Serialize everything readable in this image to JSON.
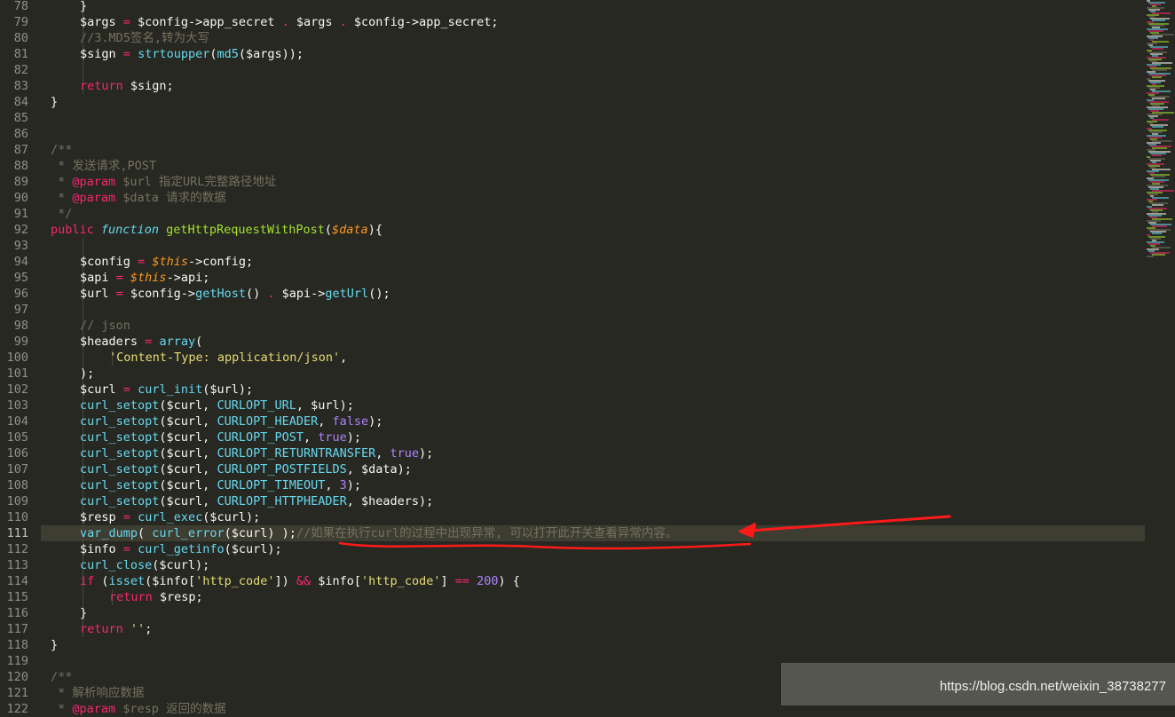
{
  "editor": {
    "theme_colors": {
      "background": "#272822",
      "foreground": "#f8f8f2",
      "keyword": "#f92672",
      "function": "#a6e22e",
      "builtin": "#66d9ef",
      "variable_italic": "#fd971f",
      "comment": "#75715e",
      "string": "#e6db74",
      "constant": "#ae81ff",
      "line_number": "#90908a",
      "active_line": "#3e3d32"
    },
    "active_line": 111,
    "lines": [
      {
        "n": "78",
        "indent": 2,
        "tokens": [
          [
            "pl",
            "}"
          ]
        ]
      },
      {
        "n": "79",
        "indent": 2,
        "tokens": [
          [
            "pl",
            "$args "
          ],
          [
            "kw",
            "="
          ],
          [
            "pl",
            " $config->app_secret "
          ],
          [
            "kw",
            "."
          ],
          [
            "pl",
            " $args "
          ],
          [
            "kw",
            "."
          ],
          [
            "pl",
            " $config->app_secret;"
          ]
        ]
      },
      {
        "n": "80",
        "indent": 2,
        "tokens": [
          [
            "cm",
            "//3.MD5签名,转为大写"
          ]
        ]
      },
      {
        "n": "81",
        "indent": 2,
        "tokens": [
          [
            "pl",
            "$sign "
          ],
          [
            "kw",
            "="
          ],
          [
            "pl",
            " "
          ],
          [
            "bi",
            "strtoupper"
          ],
          [
            "pl",
            "("
          ],
          [
            "bi",
            "md5"
          ],
          [
            "pl",
            "($args));"
          ]
        ]
      },
      {
        "n": "82",
        "indent": 2,
        "tokens": []
      },
      {
        "n": "83",
        "indent": 2,
        "tokens": [
          [
            "kw",
            "return"
          ],
          [
            "pl",
            " $sign;"
          ]
        ]
      },
      {
        "n": "84",
        "indent": 1,
        "tokens": [
          [
            "pl",
            "}"
          ]
        ]
      },
      {
        "n": "85",
        "indent": 1,
        "tokens": []
      },
      {
        "n": "86",
        "indent": 1,
        "tokens": []
      },
      {
        "n": "87",
        "indent": 1,
        "tokens": [
          [
            "cm",
            "/**"
          ]
        ]
      },
      {
        "n": "88",
        "indent": 1,
        "tokens": [
          [
            "cm",
            " * 发送请求,POST"
          ]
        ]
      },
      {
        "n": "89",
        "indent": 1,
        "tokens": [
          [
            "cm",
            " * "
          ],
          [
            "kw",
            "@param"
          ],
          [
            "cm",
            " $url 指定URL完整路径地址"
          ]
        ]
      },
      {
        "n": "90",
        "indent": 1,
        "tokens": [
          [
            "cm",
            " * "
          ],
          [
            "kw",
            "@param"
          ],
          [
            "cm",
            " $data 请求的数据"
          ]
        ]
      },
      {
        "n": "91",
        "indent": 1,
        "tokens": [
          [
            "cm",
            " */"
          ]
        ]
      },
      {
        "n": "92",
        "indent": 1,
        "tokens": [
          [
            "kw",
            "public"
          ],
          [
            "pl",
            " "
          ],
          [
            "st",
            "function"
          ],
          [
            "pl",
            " "
          ],
          [
            "fn",
            "getHttpRequestWithPost"
          ],
          [
            "pl",
            "("
          ],
          [
            "vi",
            "$data"
          ],
          [
            "pl",
            "){"
          ]
        ]
      },
      {
        "n": "93",
        "indent": 2,
        "tokens": []
      },
      {
        "n": "94",
        "indent": 2,
        "tokens": [
          [
            "pl",
            "$config "
          ],
          [
            "kw",
            "="
          ],
          [
            "pl",
            " "
          ],
          [
            "vi",
            "$this"
          ],
          [
            "pl",
            "->config;"
          ]
        ]
      },
      {
        "n": "95",
        "indent": 2,
        "tokens": [
          [
            "pl",
            "$api "
          ],
          [
            "kw",
            "="
          ],
          [
            "pl",
            " "
          ],
          [
            "vi",
            "$this"
          ],
          [
            "pl",
            "->api;"
          ]
        ]
      },
      {
        "n": "96",
        "indent": 2,
        "tokens": [
          [
            "pl",
            "$url "
          ],
          [
            "kw",
            "="
          ],
          [
            "pl",
            " $config->"
          ],
          [
            "bi",
            "getHost"
          ],
          [
            "pl",
            "() "
          ],
          [
            "kw",
            "."
          ],
          [
            "pl",
            " $api->"
          ],
          [
            "bi",
            "getUrl"
          ],
          [
            "pl",
            "();"
          ]
        ]
      },
      {
        "n": "97",
        "indent": 2,
        "tokens": []
      },
      {
        "n": "98",
        "indent": 2,
        "tokens": [
          [
            "cm",
            "// json"
          ]
        ]
      },
      {
        "n": "99",
        "indent": 2,
        "tokens": [
          [
            "pl",
            "$headers "
          ],
          [
            "kw",
            "="
          ],
          [
            "pl",
            " "
          ],
          [
            "bi",
            "array"
          ],
          [
            "pl",
            "("
          ]
        ]
      },
      {
        "n": "100",
        "indent": 3,
        "tokens": [
          [
            "str",
            "'Content-Type: application/json'"
          ],
          [
            "pl",
            ","
          ]
        ]
      },
      {
        "n": "101",
        "indent": 2,
        "tokens": [
          [
            "pl",
            ");"
          ]
        ]
      },
      {
        "n": "102",
        "indent": 2,
        "tokens": [
          [
            "pl",
            "$curl "
          ],
          [
            "kw",
            "="
          ],
          [
            "pl",
            " "
          ],
          [
            "bi",
            "curl_init"
          ],
          [
            "pl",
            "($url);"
          ]
        ]
      },
      {
        "n": "103",
        "indent": 2,
        "tokens": [
          [
            "bi",
            "curl_setopt"
          ],
          [
            "pl",
            "($curl, "
          ],
          [
            "bi",
            "CURLOPT_URL"
          ],
          [
            "pl",
            ", $url);"
          ]
        ]
      },
      {
        "n": "104",
        "indent": 2,
        "tokens": [
          [
            "bi",
            "curl_setopt"
          ],
          [
            "pl",
            "($curl, "
          ],
          [
            "bi",
            "CURLOPT_HEADER"
          ],
          [
            "pl",
            ", "
          ],
          [
            "cst",
            "false"
          ],
          [
            "pl",
            ");"
          ]
        ]
      },
      {
        "n": "105",
        "indent": 2,
        "tokens": [
          [
            "bi",
            "curl_setopt"
          ],
          [
            "pl",
            "($curl, "
          ],
          [
            "bi",
            "CURLOPT_POST"
          ],
          [
            "pl",
            ", "
          ],
          [
            "cst",
            "true"
          ],
          [
            "pl",
            ");"
          ]
        ]
      },
      {
        "n": "106",
        "indent": 2,
        "tokens": [
          [
            "bi",
            "curl_setopt"
          ],
          [
            "pl",
            "($curl, "
          ],
          [
            "bi",
            "CURLOPT_RETURNTRANSFER"
          ],
          [
            "pl",
            ", "
          ],
          [
            "cst",
            "true"
          ],
          [
            "pl",
            ");"
          ]
        ]
      },
      {
        "n": "107",
        "indent": 2,
        "tokens": [
          [
            "bi",
            "curl_setopt"
          ],
          [
            "pl",
            "($curl, "
          ],
          [
            "bi",
            "CURLOPT_POSTFIELDS"
          ],
          [
            "pl",
            ", $data);"
          ]
        ]
      },
      {
        "n": "108",
        "indent": 2,
        "tokens": [
          [
            "bi",
            "curl_setopt"
          ],
          [
            "pl",
            "($curl, "
          ],
          [
            "bi",
            "CURLOPT_TIMEOUT"
          ],
          [
            "pl",
            ", "
          ],
          [
            "num",
            "3"
          ],
          [
            "pl",
            ");"
          ]
        ]
      },
      {
        "n": "109",
        "indent": 2,
        "tokens": [
          [
            "bi",
            "curl_setopt"
          ],
          [
            "pl",
            "($curl, "
          ],
          [
            "bi",
            "CURLOPT_HTTPHEADER"
          ],
          [
            "pl",
            ", $headers);"
          ]
        ]
      },
      {
        "n": "110",
        "indent": 2,
        "tokens": [
          [
            "pl",
            "$resp "
          ],
          [
            "kw",
            "="
          ],
          [
            "pl",
            " "
          ],
          [
            "bi",
            "curl_exec"
          ],
          [
            "pl",
            "($curl);"
          ]
        ]
      },
      {
        "n": "111",
        "indent": 2,
        "tokens": [
          [
            "bi",
            "var_dump"
          ],
          [
            "pl",
            "( "
          ],
          [
            "bi",
            "curl_error"
          ],
          [
            "pl",
            "($curl) );"
          ],
          [
            "cm",
            "//如果在执行curl的过程中出现异常, 可以打开此开关查看异常内容。"
          ]
        ]
      },
      {
        "n": "112",
        "indent": 2,
        "tokens": [
          [
            "pl",
            "$info "
          ],
          [
            "kw",
            "="
          ],
          [
            "pl",
            " "
          ],
          [
            "bi",
            "curl_getinfo"
          ],
          [
            "pl",
            "($curl);"
          ]
        ]
      },
      {
        "n": "113",
        "indent": 2,
        "tokens": [
          [
            "bi",
            "curl_close"
          ],
          [
            "pl",
            "($curl);"
          ]
        ]
      },
      {
        "n": "114",
        "indent": 2,
        "tokens": [
          [
            "kw",
            "if"
          ],
          [
            "pl",
            " ("
          ],
          [
            "bi",
            "isset"
          ],
          [
            "pl",
            "($info["
          ],
          [
            "str",
            "'http_code'"
          ],
          [
            "pl",
            "]) "
          ],
          [
            "kw",
            "&&"
          ],
          [
            "pl",
            " $info["
          ],
          [
            "str",
            "'http_code'"
          ],
          [
            "pl",
            "] "
          ],
          [
            "kw",
            "=="
          ],
          [
            "pl",
            " "
          ],
          [
            "num",
            "200"
          ],
          [
            "pl",
            ") {"
          ]
        ]
      },
      {
        "n": "115",
        "indent": 3,
        "tokens": [
          [
            "kw",
            "return"
          ],
          [
            "pl",
            " $resp;"
          ]
        ]
      },
      {
        "n": "116",
        "indent": 2,
        "tokens": [
          [
            "pl",
            "}"
          ]
        ]
      },
      {
        "n": "117",
        "indent": 2,
        "tokens": [
          [
            "kw",
            "return"
          ],
          [
            "pl",
            " "
          ],
          [
            "str",
            "''"
          ],
          [
            "pl",
            ";"
          ]
        ]
      },
      {
        "n": "118",
        "indent": 1,
        "tokens": [
          [
            "pl",
            "}"
          ]
        ]
      },
      {
        "n": "119",
        "indent": 1,
        "tokens": []
      },
      {
        "n": "120",
        "indent": 1,
        "tokens": [
          [
            "cm",
            "/**"
          ]
        ]
      },
      {
        "n": "121",
        "indent": 1,
        "tokens": [
          [
            "cm",
            " * 解析响应数据"
          ]
        ]
      },
      {
        "n": "122",
        "indent": 1,
        "tokens": [
          [
            "cm",
            " * "
          ],
          [
            "kw",
            "@param"
          ],
          [
            "cm",
            " $resp 返回的数据"
          ]
        ]
      }
    ]
  },
  "annotation": {
    "color": "#ff1a1a"
  },
  "watermark": {
    "text": "https://blog.csdn.net/weixin_38738277"
  }
}
